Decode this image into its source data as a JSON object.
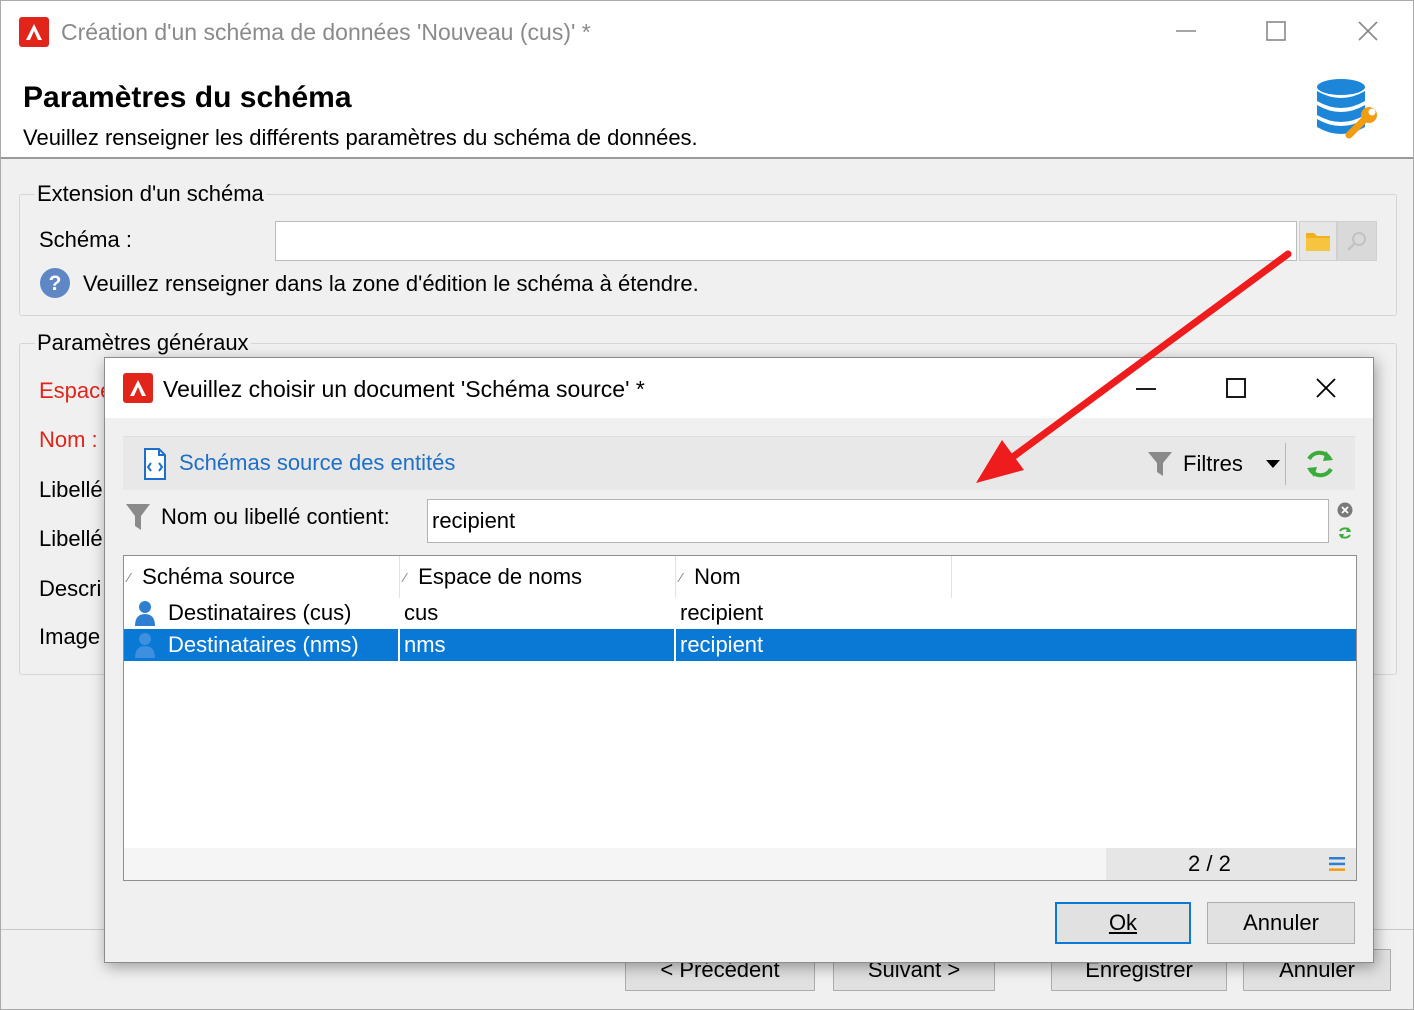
{
  "main_window": {
    "title": "Création d'un schéma de données 'Nouveau (cus)' *",
    "page_title": "Paramètres du schéma",
    "page_subtitle": "Veuillez renseigner les différents paramètres du schéma de données.",
    "extension_group": {
      "legend": "Extension d'un schéma",
      "schema_label": "Schéma :",
      "schema_value": "",
      "hint": "Veuillez renseigner dans la zone d'édition le schéma à étendre."
    },
    "general_group": {
      "legend": "Paramètres généraux",
      "labels": [
        "Espace",
        "Nom :",
        "Libellé",
        "Libellé",
        "Descri",
        "Image"
      ]
    },
    "buttons": {
      "previous": "< Précédent",
      "next": "Suivant >",
      "save": "Enregistrer",
      "cancel": "Annuler"
    }
  },
  "dialog": {
    "title": "Veuillez choisir un document 'Schéma source' *",
    "toolbar": {
      "link": "Schémas source des entités",
      "filters": "Filtres"
    },
    "filter": {
      "label": "Nom ou libellé contient:",
      "value": "recipient"
    },
    "grid": {
      "columns": [
        "Schéma source",
        "Espace de noms",
        "Nom"
      ],
      "rows": [
        {
          "source": "Destinataires (cus)",
          "namespace": "cus",
          "name": "recipient",
          "selected": false
        },
        {
          "source": "Destinataires (nms)",
          "namespace": "nms",
          "name": "recipient",
          "selected": true
        }
      ],
      "count": "2 / 2"
    },
    "buttons": {
      "ok": "Ok",
      "cancel": "Annuler"
    }
  },
  "colors": {
    "brand": "#e1251b",
    "selection": "#0a79d5",
    "link": "#1d6fc7",
    "annotation_arrow": "#ee1c1c"
  },
  "icons": [
    "adobe-logo-icon",
    "minimize-icon",
    "maximize-icon",
    "close-icon",
    "database-wrench-icon",
    "folder-icon",
    "search-icon",
    "help-icon",
    "document-icon",
    "filter-icon",
    "dropdown-arrow-icon",
    "refresh-icon",
    "clear-icon",
    "user-icon",
    "list-icon"
  ]
}
